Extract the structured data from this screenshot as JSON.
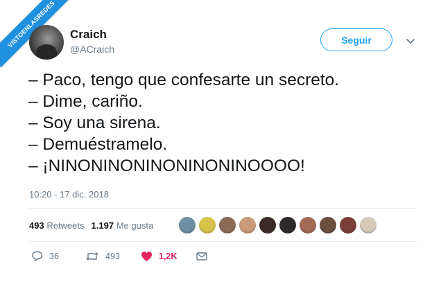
{
  "watermark": "VISTOENLASREDES",
  "author": {
    "name": "Craich",
    "handle": "@ACraich"
  },
  "follow_label": "Seguir",
  "lines": [
    "– Paco, tengo que confesarte un secreto.",
    "– Dime, cariño.",
    "– Soy una sirena.",
    "– Demuéstramelo.",
    "– ¡NINONINONINONINONINOOOO!"
  ],
  "timestamp": "10:20 - 17 dic. 2018",
  "stats": {
    "retweets_count": "493",
    "retweets_label": "Retweets",
    "likes_count": "1.197",
    "likes_label": "Me gusta"
  },
  "likers": [
    "#6f8fa3",
    "#d9c24a",
    "#8a6a55",
    "#c89a7a",
    "#3a2b28",
    "#2f2a2a",
    "#a36a55",
    "#6a4e3e",
    "#7b3f3a",
    "#d8c8b8"
  ],
  "actions": {
    "reply_count": "36",
    "retweet_count": "493",
    "like_count": "1,2K"
  },
  "colors": {
    "accent": "#1da1f2",
    "like": "#e0245e",
    "muted": "#657786"
  }
}
